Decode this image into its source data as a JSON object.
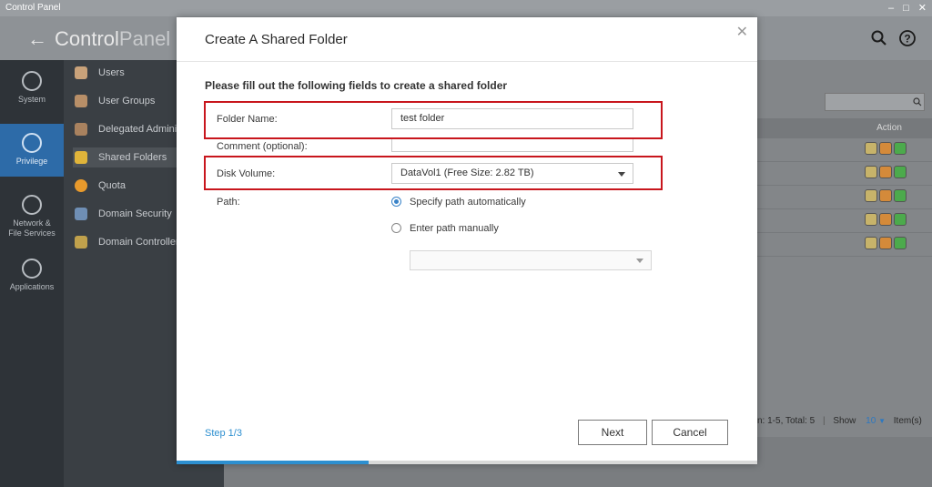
{
  "window": {
    "title": "Control Panel"
  },
  "app_header": {
    "title_dark": "Control",
    "title_light": "Panel"
  },
  "rail": [
    {
      "label": "System",
      "icon": "gear-icon"
    },
    {
      "label": "Privilege",
      "icon": "person-icon",
      "active": true
    },
    {
      "label_line1": "Network &",
      "label_line2": "File Services",
      "icon": "globe-icon"
    },
    {
      "label": "Applications",
      "icon": "grid-icon"
    }
  ],
  "submenu": [
    {
      "label": "Users",
      "icon": "user-icon"
    },
    {
      "label": "User Groups",
      "icon": "user-group-icon"
    },
    {
      "label": "Delegated Admini",
      "icon": "delegated-admin-icon"
    },
    {
      "label": "Shared Folders",
      "icon": "folder-icon",
      "active": true
    },
    {
      "label": "Quota",
      "icon": "quota-icon"
    },
    {
      "label": "Domain Security",
      "icon": "domain-security-icon"
    },
    {
      "label": "Domain Controller",
      "icon": "domain-controller-icon"
    }
  ],
  "content": {
    "action_header": "Action",
    "footer": {
      "range": "n: 1-5, Total: 5",
      "show_label": "Show",
      "show_value": "10",
      "items_label": "Item(s)"
    }
  },
  "dialog": {
    "title": "Create A Shared Folder",
    "intro": "Please fill out the following fields to create a shared folder",
    "folder_name_label": "Folder Name:",
    "folder_name_value": "test folder",
    "comment_label": "Comment (optional):",
    "comment_value": "",
    "disk_volume_label": "Disk Volume:",
    "disk_volume_value": "DataVol1 (Free Size: 2.82 TB)",
    "path_label": "Path:",
    "path_auto": "Specify path automatically",
    "path_manual": "Enter path manually",
    "path_selected": "auto",
    "step": "Step 1/3",
    "next": "Next",
    "cancel": "Cancel",
    "progress": 0.33
  },
  "colors": {
    "accent": "#2d8fd0",
    "highlight": "#c8161d",
    "rail_active": "#2d6ba8"
  }
}
